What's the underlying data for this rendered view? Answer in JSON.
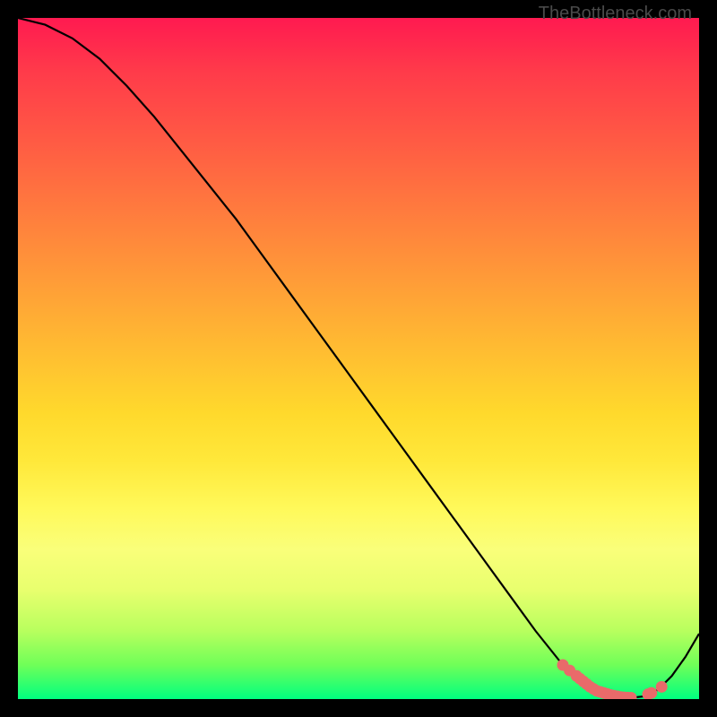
{
  "watermark": "TheBottleneck.com",
  "colors": {
    "curve_stroke": "#000000",
    "marker_fill": "#e96a6a",
    "marker_stroke": "#e96a6a"
  },
  "chart_data": {
    "type": "line",
    "title": "",
    "xlabel": "",
    "ylabel": "",
    "xlim": [
      0,
      100
    ],
    "ylim": [
      0,
      100
    ],
    "curve_points": {
      "x": [
        0,
        4,
        8,
        12,
        16,
        20,
        24,
        28,
        32,
        36,
        40,
        44,
        48,
        52,
        56,
        60,
        64,
        68,
        72,
        76,
        80,
        84,
        86,
        88,
        90,
        92,
        94,
        96,
        98,
        100
      ],
      "y": [
        100,
        99,
        97,
        94,
        90,
        85.5,
        80.5,
        75.5,
        70.5,
        65,
        59.5,
        54,
        48.5,
        43,
        37.5,
        32,
        26.5,
        21,
        15.5,
        10,
        5,
        1.8,
        0.9,
        0.4,
        0.2,
        0.4,
        1.4,
        3.4,
        6.2,
        9.6
      ]
    },
    "marker_points": {
      "x": [
        80,
        81,
        82,
        82.5,
        83,
        83.5,
        84,
        84.5,
        85,
        85.5,
        86,
        86.5,
        87,
        87.5,
        88,
        88.5,
        89,
        89.5,
        90,
        92.5,
        93,
        94.5
      ],
      "y": [
        5,
        4.2,
        3.4,
        3.0,
        2.6,
        2.2,
        1.8,
        1.5,
        1.2,
        1.05,
        0.9,
        0.75,
        0.6,
        0.5,
        0.4,
        0.3,
        0.25,
        0.22,
        0.2,
        0.7,
        0.9,
        1.8
      ]
    }
  }
}
